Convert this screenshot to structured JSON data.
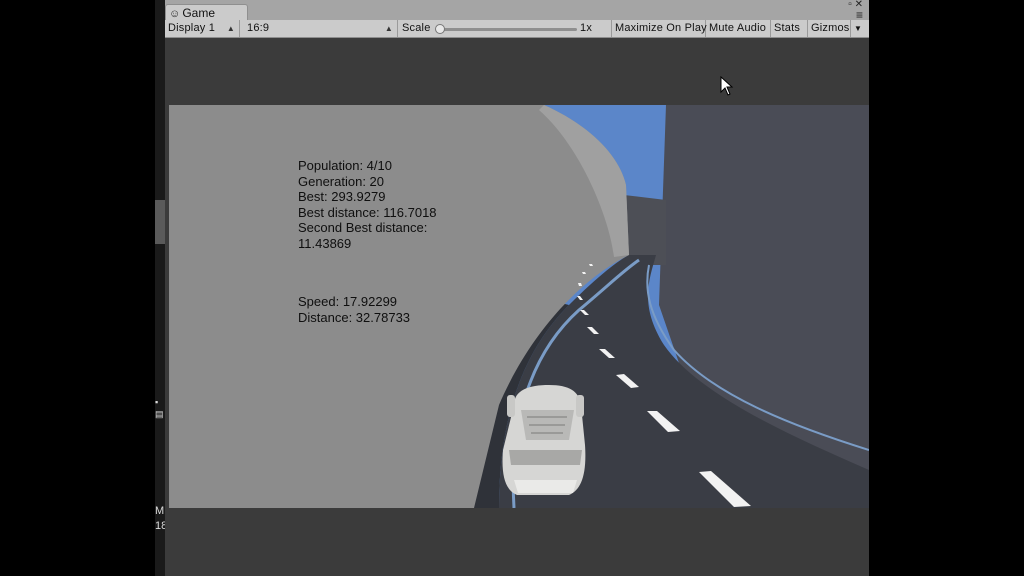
{
  "window": {
    "tab_title": "Game",
    "tab_icon": "gamepad-icon"
  },
  "toolbar": {
    "display": "Display 1",
    "aspect": "16:9",
    "scale_label": "Scale",
    "scale_value": "1x",
    "scale_level": 0.0,
    "maximize_on_play": "Maximize On Play",
    "mute_audio": "Mute Audio",
    "stats": "Stats",
    "gizmos": "Gizmos"
  },
  "hud": {
    "population": "Population: 4/10",
    "generation": "Generation: 20",
    "best": "Best: 293.9279",
    "best_distance": "Best distance: 116.7018",
    "second_best_label": "Second Best distance:",
    "second_best_value": "11.43869",
    "speed": "Speed: 17.92299",
    "distance": "Distance: 32.78733"
  },
  "left_strip": {
    "text_m": "M",
    "text_18": "18"
  },
  "colors": {
    "editor_bg": "#3b3b3b",
    "toolbar_bg": "#cbcbcb",
    "sky": "#5b86c9",
    "wall_left": "#8a8a8a",
    "wall_right": "#4a4c56",
    "road": "#3a3d45"
  }
}
